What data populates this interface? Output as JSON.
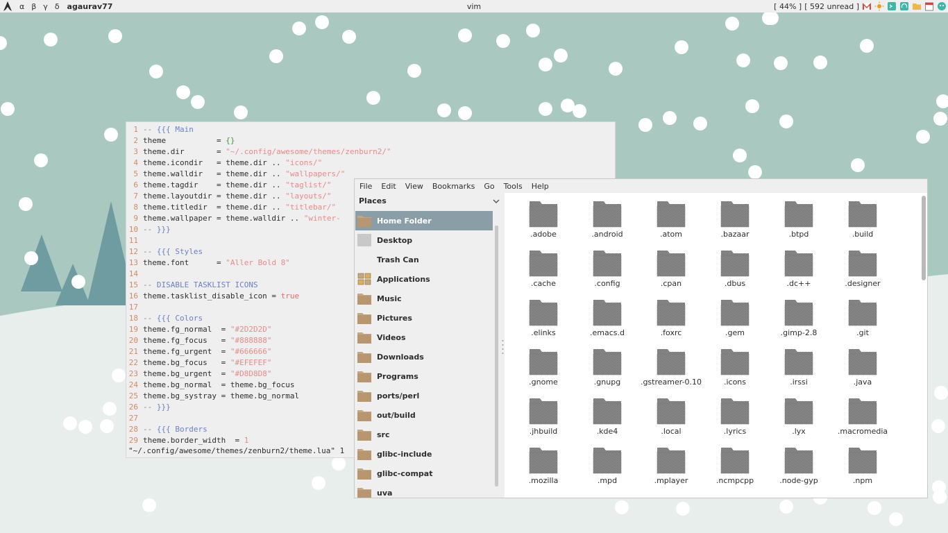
{
  "colors": {
    "wallpaper_sky": "#a8c8c0",
    "snow_ground": "#e8eeec",
    "tree": "#6e9ca0",
    "selection": "#8a9ea8",
    "folder": "#c4a882"
  },
  "topbar": {
    "launcher_icon": "arch-logo-icon",
    "tags": [
      "α",
      "β",
      "γ",
      "δ"
    ],
    "user": "agaurav77",
    "window_title": "vim",
    "battery": "[ 44% ]",
    "mail": "[ 592 unread ]",
    "tray_icons": [
      "gmail-icon",
      "brightness-icon",
      "terminal-icon",
      "headphones-icon",
      "folder-icon",
      "calendar-icon",
      "app-icon"
    ]
  },
  "vim": {
    "lines": [
      {
        "n": "1",
        "parts": [
          {
            "t": "-- {{{ Main",
            "c": "comment"
          }
        ]
      },
      {
        "n": "2",
        "parts": [
          {
            "t": "t",
            "c": "cursor"
          },
          {
            "t": "heme           = ",
            "c": ""
          },
          {
            "t": "{}",
            "c": "brace"
          }
        ]
      },
      {
        "n": "3",
        "parts": [
          {
            "t": "theme.dir       = ",
            "c": ""
          },
          {
            "t": "\"~/.config/awesome/themes/zenburn2/\"",
            "c": "string"
          }
        ]
      },
      {
        "n": "4",
        "parts": [
          {
            "t": "theme.icondir   = theme.dir .. ",
            "c": ""
          },
          {
            "t": "\"icons/\"",
            "c": "string"
          }
        ]
      },
      {
        "n": "5",
        "parts": [
          {
            "t": "theme.walldir   = theme.dir .. ",
            "c": ""
          },
          {
            "t": "\"wallpapers/\"",
            "c": "string"
          }
        ]
      },
      {
        "n": "6",
        "parts": [
          {
            "t": "theme.tagdir    = theme.dir .. ",
            "c": ""
          },
          {
            "t": "\"taglist/\"",
            "c": "string"
          }
        ]
      },
      {
        "n": "7",
        "parts": [
          {
            "t": "theme.layoutdir = theme.dir .. ",
            "c": ""
          },
          {
            "t": "\"layouts/\"",
            "c": "string"
          }
        ]
      },
      {
        "n": "8",
        "parts": [
          {
            "t": "theme.titledir  = theme.dir .. ",
            "c": ""
          },
          {
            "t": "\"titlebar/\"",
            "c": "string"
          }
        ]
      },
      {
        "n": "9",
        "parts": [
          {
            "t": "theme.wallpaper = theme.walldir .. ",
            "c": ""
          },
          {
            "t": "\"winter-",
            "c": "string"
          }
        ]
      },
      {
        "n": "10",
        "parts": [
          {
            "t": "-- }}}",
            "c": "comment"
          }
        ]
      },
      {
        "n": "11",
        "parts": []
      },
      {
        "n": "12",
        "parts": [
          {
            "t": "-- {{{ Styles",
            "c": "comment"
          }
        ]
      },
      {
        "n": "13",
        "parts": [
          {
            "t": "theme.font      = ",
            "c": ""
          },
          {
            "t": "\"Aller Bold 8\"",
            "c": "string"
          }
        ]
      },
      {
        "n": "14",
        "parts": []
      },
      {
        "n": "15",
        "parts": [
          {
            "t": "-- DISABLE TASKLIST ICONS",
            "c": "comment"
          }
        ]
      },
      {
        "n": "16",
        "parts": [
          {
            "t": "theme.tasklist_disable_icon = ",
            "c": ""
          },
          {
            "t": "true",
            "c": "bool"
          }
        ]
      },
      {
        "n": "17",
        "parts": []
      },
      {
        "n": "18",
        "parts": [
          {
            "t": "-- {{{ Colors",
            "c": "comment"
          }
        ]
      },
      {
        "n": "19",
        "parts": [
          {
            "t": "theme.fg_normal  = ",
            "c": ""
          },
          {
            "t": "\"#2D2D2D\"",
            "c": "string"
          }
        ]
      },
      {
        "n": "20",
        "parts": [
          {
            "t": "theme.fg_focus   = ",
            "c": ""
          },
          {
            "t": "\"#888888\"",
            "c": "string"
          }
        ]
      },
      {
        "n": "21",
        "parts": [
          {
            "t": "theme.fg_urgent  = ",
            "c": ""
          },
          {
            "t": "\"#666666\"",
            "c": "string"
          }
        ]
      },
      {
        "n": "22",
        "parts": [
          {
            "t": "theme.bg_focus   = ",
            "c": ""
          },
          {
            "t": "\"#EFEFEF\"",
            "c": "string"
          }
        ]
      },
      {
        "n": "23",
        "parts": [
          {
            "t": "theme.bg_urgent  = ",
            "c": ""
          },
          {
            "t": "\"#D8D8D8\"",
            "c": "string"
          }
        ]
      },
      {
        "n": "24",
        "parts": [
          {
            "t": "theme.bg_normal  = theme.bg_focus",
            "c": ""
          }
        ]
      },
      {
        "n": "25",
        "parts": [
          {
            "t": "theme.bg_systray = theme.bg_normal",
            "c": ""
          }
        ]
      },
      {
        "n": "26",
        "parts": [
          {
            "t": "-- }}}",
            "c": "comment"
          }
        ]
      },
      {
        "n": "27",
        "parts": []
      },
      {
        "n": "28",
        "parts": [
          {
            "t": "-- {{{ Borders",
            "c": "comment"
          }
        ]
      },
      {
        "n": "29",
        "parts": [
          {
            "t": "theme.border_width  = ",
            "c": ""
          },
          {
            "t": "1",
            "c": "string"
          }
        ]
      }
    ],
    "cmdline": "\"~/.config/awesome/themes/zenburn2/theme.lua\" 1"
  },
  "file_manager": {
    "menu": [
      "File",
      "Edit",
      "View",
      "Bookmarks",
      "Go",
      "Tools",
      "Help"
    ],
    "places_title": "Places",
    "places": [
      {
        "label": "Home Folder",
        "icon": "home-folder-icon",
        "selected": true
      },
      {
        "label": "Desktop",
        "icon": "desktop-icon"
      },
      {
        "label": "Trash Can",
        "icon": "trash-icon"
      },
      {
        "label": "Applications",
        "icon": "applications-icon"
      },
      {
        "label": "Music",
        "icon": "folder-icon"
      },
      {
        "label": "Pictures",
        "icon": "folder-icon"
      },
      {
        "label": "Videos",
        "icon": "folder-icon"
      },
      {
        "label": "Downloads",
        "icon": "folder-icon"
      },
      {
        "label": "Programs",
        "icon": "folder-icon"
      },
      {
        "label": "ports/perl",
        "icon": "folder-icon"
      },
      {
        "label": "out/build",
        "icon": "folder-icon"
      },
      {
        "label": "src",
        "icon": "folder-icon"
      },
      {
        "label": "glibc-include",
        "icon": "folder-icon"
      },
      {
        "label": "glibc-compat",
        "icon": "folder-icon"
      },
      {
        "label": "uva",
        "icon": "folder-icon"
      }
    ],
    "files": [
      ".adobe",
      ".android",
      ".atom",
      ".bazaar",
      ".btpd",
      ".build",
      ".cache",
      ".config",
      ".cpan",
      ".dbus",
      ".dc++",
      ".designer",
      ".elinks",
      ".emacs.d",
      ".foxrc",
      ".gem",
      ".gimp-2.8",
      ".git",
      ".gnome",
      ".gnupg",
      ".gstreamer-0.10",
      ".icons",
      ".irssi",
      ".java",
      ".jhbuild",
      ".kde4",
      ".local",
      ".lyrics",
      ".lyx",
      ".macromedia",
      ".mozilla",
      ".mpd",
      ".mplayer",
      ".ncmpcpp",
      ".node-gyp",
      ".npm"
    ]
  }
}
